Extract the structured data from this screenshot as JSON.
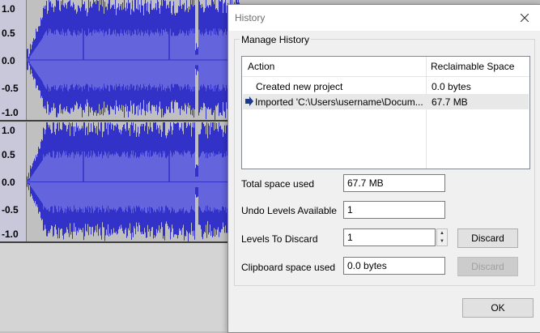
{
  "tracks": [
    {
      "ticks": [
        "1.0",
        "0.5",
        "0.0",
        "-0.5",
        "-1.0"
      ]
    },
    {
      "ticks": [
        "1.0",
        "0.5",
        "0.0",
        "-0.5",
        "-1.0"
      ]
    }
  ],
  "colors": {
    "waveform": "#3232c8",
    "waveform_rms": "#6464dc",
    "ruler": "#c8c8da"
  },
  "dialog": {
    "title": "History",
    "group_label": "Manage History",
    "columns": [
      "Action",
      "Reclaimable Space"
    ],
    "rows": [
      {
        "action": "Created new project",
        "space": "0.0 bytes",
        "current": false
      },
      {
        "action": "Imported 'C:\\Users\\username\\Docum...",
        "space": "67.7 MB",
        "current": true
      }
    ],
    "total_space_label": "Total space used",
    "total_space_value": "67.7 MB",
    "undo_levels_label": "Undo Levels Available",
    "undo_levels_value": "1",
    "levels_discard_label": "Levels To Discard",
    "levels_discard_value": "1",
    "discard_label": "Discard",
    "clipboard_label": "Clipboard space used",
    "clipboard_value": "0.0 bytes",
    "discard_clipboard_label": "Discard",
    "ok_label": "OK"
  }
}
